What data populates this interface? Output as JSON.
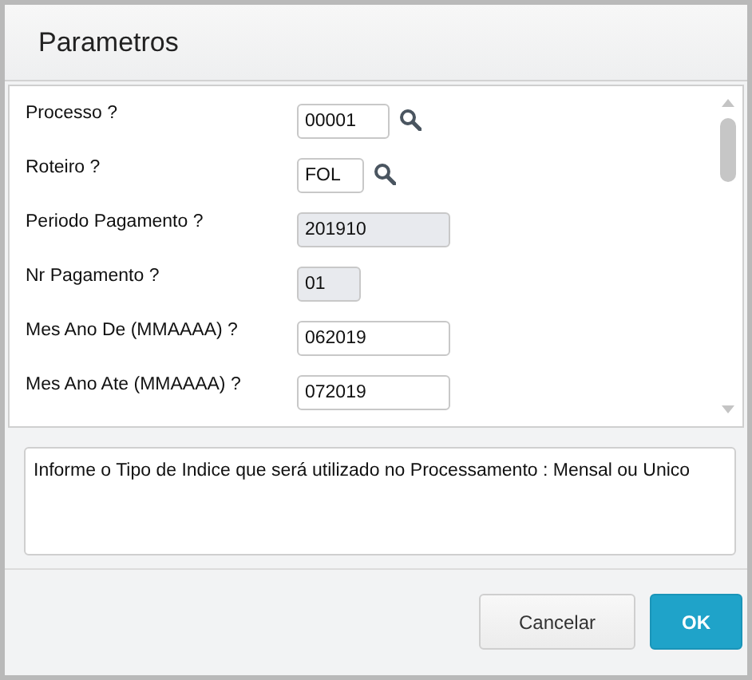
{
  "window": {
    "title": "Parametros"
  },
  "fields": [
    {
      "label": "Processo ?",
      "value": "00001",
      "disabled": false,
      "lookup": true
    },
    {
      "label": "Roteiro ?",
      "value": "FOL",
      "disabled": false,
      "lookup": true
    },
    {
      "label": "Periodo Pagamento ?",
      "value": "201910",
      "disabled": true,
      "lookup": false
    },
    {
      "label": "Nr Pagamento ?",
      "value": "01",
      "disabled": true,
      "lookup": false
    },
    {
      "label": "Mes Ano De (MMAAAA) ?",
      "value": "062019",
      "disabled": false,
      "lookup": false
    },
    {
      "label": "Mes Ano Ate (MMAAAA) ?",
      "value": "072019",
      "disabled": false,
      "lookup": false
    }
  ],
  "help": "Informe o Tipo de Indice que será utilizado no Processamento : Mensal ou Unico",
  "buttons": [
    {
      "label": "Cancelar",
      "kind": "secondary"
    },
    {
      "label": "OK",
      "kind": "primary"
    }
  ]
}
